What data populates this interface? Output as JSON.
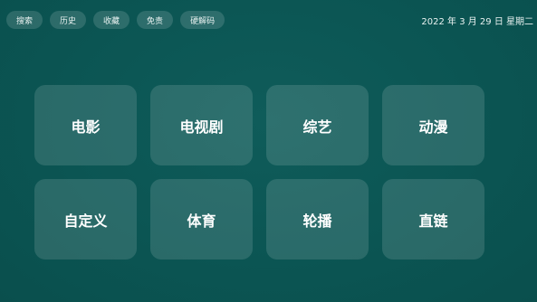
{
  "topbar": {
    "buttons": [
      {
        "label": "搜索"
      },
      {
        "label": "历史"
      },
      {
        "label": "收藏"
      },
      {
        "label": "免责"
      },
      {
        "label": "硬解码"
      }
    ]
  },
  "datetime": "2022 年 3 月 29 日 星期二",
  "tiles": [
    {
      "label": "电影"
    },
    {
      "label": "电视剧"
    },
    {
      "label": "综艺"
    },
    {
      "label": "动漫"
    },
    {
      "label": "自定义"
    },
    {
      "label": "体育"
    },
    {
      "label": "轮播"
    },
    {
      "label": "直链"
    }
  ],
  "colors": {
    "background": "#0b5553",
    "tile": "#2a6e6b",
    "pill": "#2d6c6a"
  }
}
